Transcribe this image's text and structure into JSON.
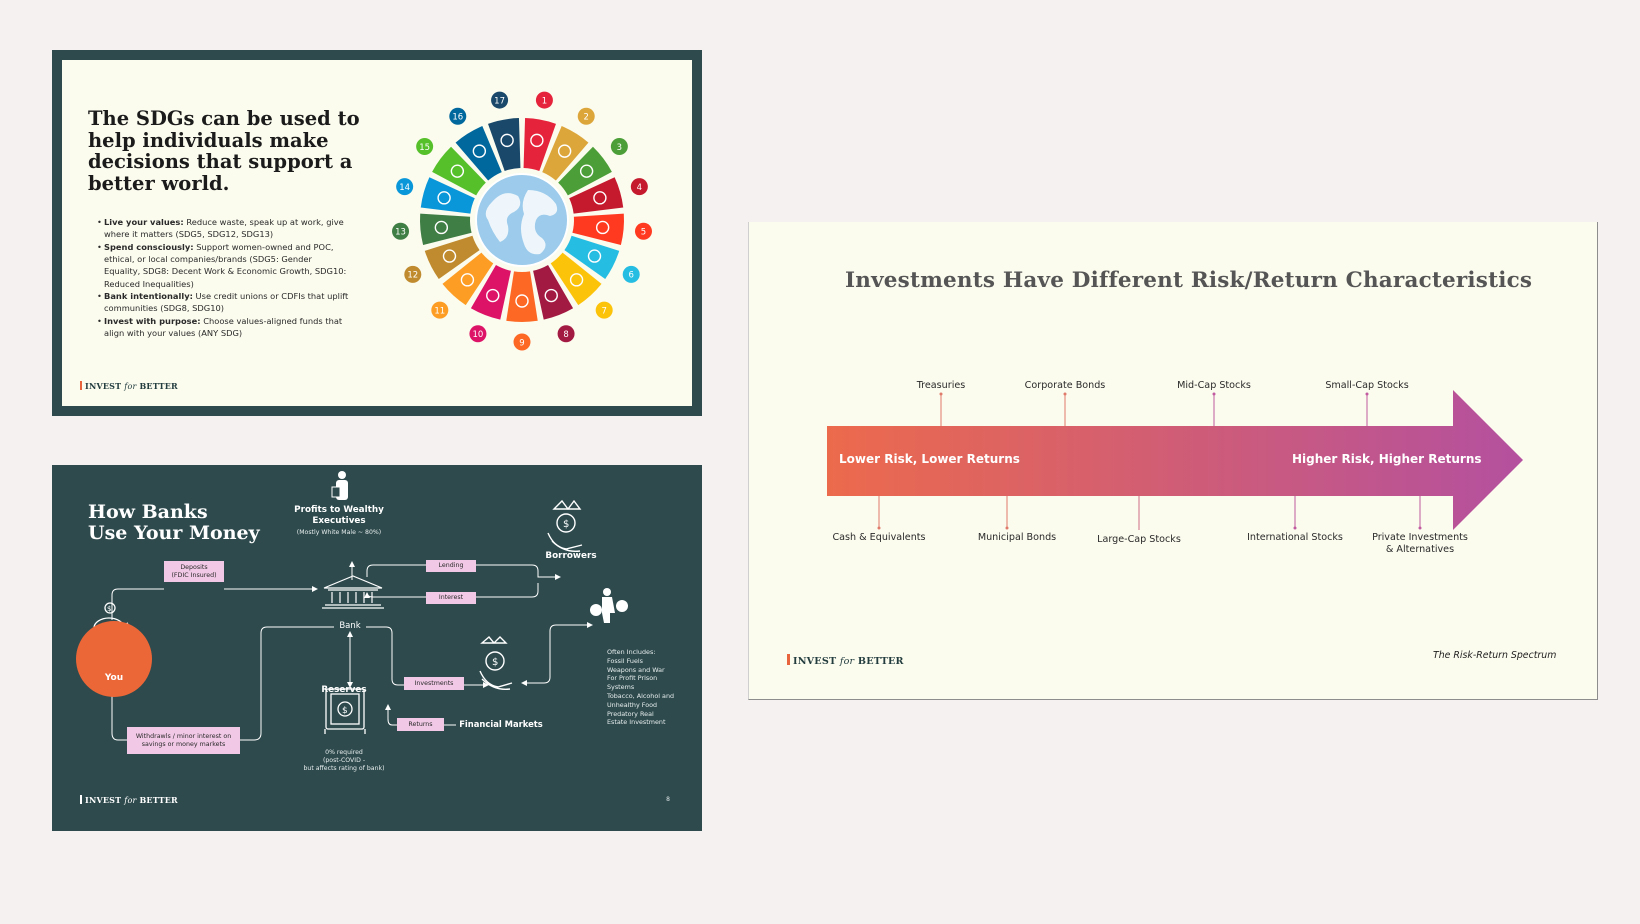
{
  "slide1": {
    "title": "The SDGs can be used to help individuals make decisions that support a better world.",
    "bullets": [
      {
        "head": "Live your values:",
        "text": " Reduce waste, speak up at work, give where it matters (SDG5, SDG12, SDG13)"
      },
      {
        "head": "Spend consciously:",
        "text": " Support women-owned and POC, ethical, or local companies/brands (SDG5: Gender Equality, SDG8: Decent Work & Economic Growth, SDG10: Reduced Inequalities)"
      },
      {
        "head": "Bank intentionally:",
        "text": " Use credit unions or CDFIs that uplift communities (SDG8, SDG10)"
      },
      {
        "head": "Invest with purpose:",
        "text": " Choose values-aligned funds that align with your values (ANY SDG)"
      }
    ],
    "brand": {
      "pre": "INVEST ",
      "mid": "for",
      "post": " BETTER"
    },
    "sdg_numbers": [
      "1",
      "2",
      "3",
      "4",
      "5",
      "6",
      "7",
      "8",
      "9",
      "10",
      "11",
      "12",
      "13",
      "14",
      "15",
      "16",
      "17"
    ],
    "sdg_colors": [
      "#e5243b",
      "#dda63a",
      "#4c9f38",
      "#c5192d",
      "#ff3a21",
      "#26bde2",
      "#fcc30b",
      "#a21942",
      "#fd6925",
      "#dd1367",
      "#fd9d24",
      "#bf8b2e",
      "#3f7e44",
      "#0a97d9",
      "#56c02b",
      "#00689d",
      "#19486a"
    ]
  },
  "slide2": {
    "title": "Investments Have Different Risk/Return Characteristics",
    "left_label": "Lower Risk, Lower Returns",
    "right_label": "Higher Risk, Higher Returns",
    "top_items": [
      "Treasuries",
      "Corporate Bonds",
      "Mid-Cap Stocks",
      "Small-Cap Stocks"
    ],
    "bottom_items": [
      "Cash & Equivalents",
      "Municipal Bonds",
      "Large-Cap Stocks",
      "International Stocks",
      "Private Investments",
      "& Alternatives"
    ],
    "caption": "The Risk-Return Spectrum",
    "brand": {
      "pre": "INVEST ",
      "mid": "for",
      "post": " BETTER"
    },
    "colors": {
      "start": "#ec6a4c",
      "end": "#b4509f"
    }
  },
  "slide3": {
    "title_line1": "How Banks",
    "title_line2": "Use Your Money",
    "profits": "Profits to Wealthy Executives",
    "profits_sub": "(Mostly White Male ~ 80%)",
    "borrowers": "Borrowers",
    "lending": "Lending",
    "interest": "Interest",
    "deposits_1": "Deposits",
    "deposits_2": "(FDIC Insured)",
    "bank": "Bank",
    "you": "You",
    "reserves": "Reserves",
    "reserves_note": [
      "0% required",
      "(post-COVID -",
      "but affects rating of bank)"
    ],
    "investments": "Investments",
    "returns": "Returns",
    "financial_markets": "Financial Markets",
    "withdrawals_1": "Withdrawls / minor interest on",
    "withdrawals_2": "savings or money markets",
    "often": [
      "Often Includes:",
      "Fossil Fuels",
      "Weapons and War",
      "For Profit Prison",
      "Systems",
      "Tobacco, Alcohol and",
      "Unhealthy Food",
      "Predatory Real",
      "Estate Investment"
    ],
    "page": "8",
    "brand": {
      "pre": "INVEST ",
      "mid": "for",
      "post": " BETTER"
    },
    "colors": {
      "bg": "#2e4a4d",
      "pink": "#f1c9e6",
      "orange": "#ec6737"
    }
  }
}
